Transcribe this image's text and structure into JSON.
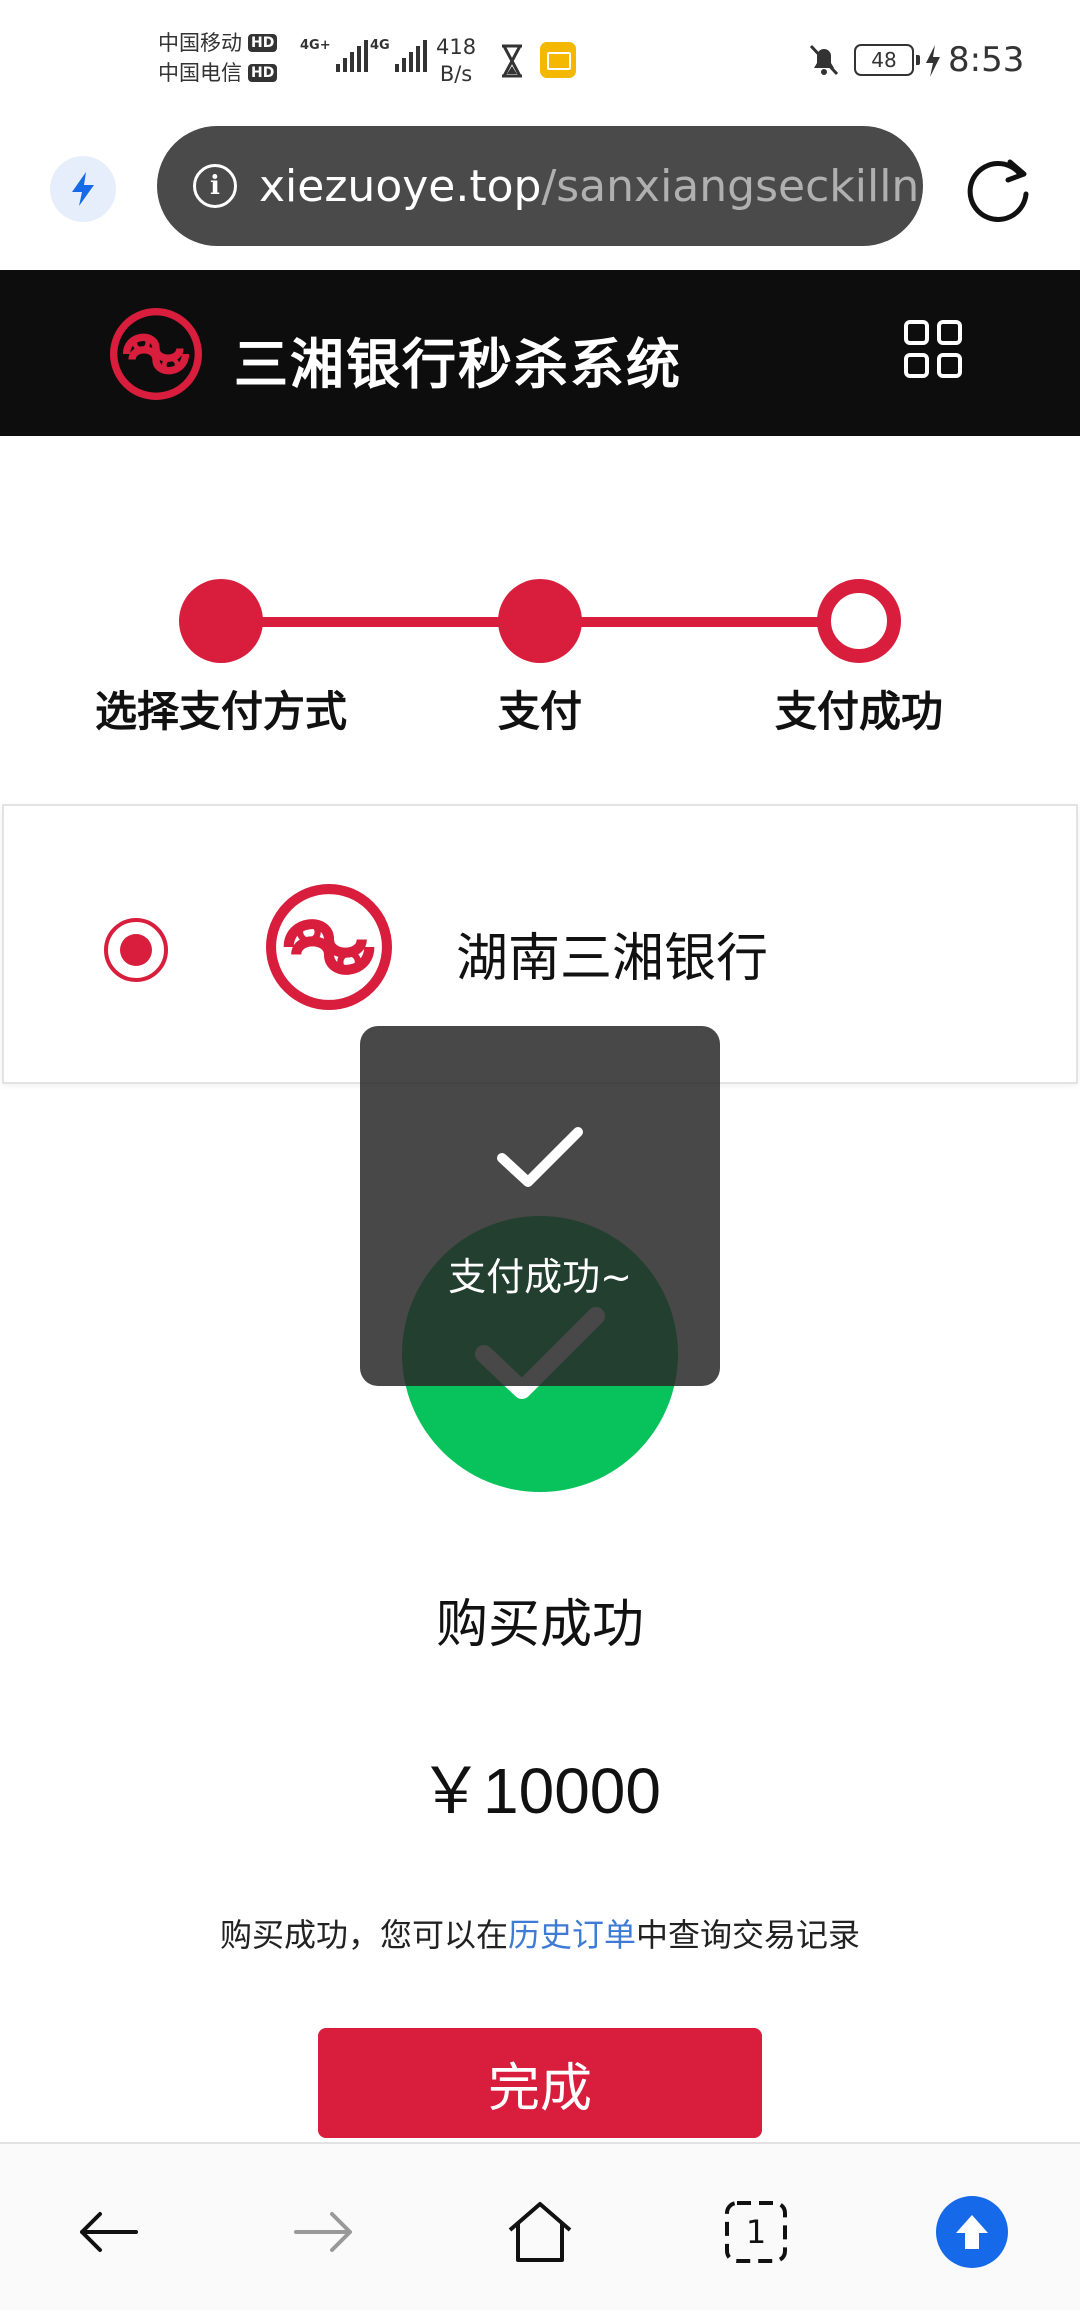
{
  "status_bar": {
    "carrier_1": "中国移动",
    "carrier_2": "中国电信",
    "hd_label": "HD",
    "signal_1_tag": "4G+",
    "signal_2_tag": "4G",
    "net_speed_value": "418",
    "net_speed_unit": "B/s",
    "battery": "48",
    "time": "8:53"
  },
  "browser": {
    "url_host": "xiezuoye.top",
    "url_path": "/sanxiangseckilln"
  },
  "site": {
    "title": "三湘银行秒杀系统",
    "accent_color": "#d81e3c"
  },
  "steps": [
    {
      "label": "选择支付方式",
      "state": "done"
    },
    {
      "label": "支付",
      "state": "done"
    },
    {
      "label": "支付成功",
      "state": "current"
    }
  ],
  "payment_method": {
    "bank_name": "湖南三湘银行",
    "selected": true
  },
  "result": {
    "title": "购买成功",
    "amount": "￥10000",
    "hint_prefix": "购买成功，您可以在",
    "hint_link": "历史订单",
    "hint_suffix": "中查询交易记录",
    "done_label": "完成",
    "success_color": "#08c25c"
  },
  "toast": {
    "text": "支付成功~"
  },
  "bottom_nav": {
    "tab_count": "1",
    "icons": [
      "back-arrow-icon",
      "forward-arrow-icon",
      "home-icon",
      "tabs-icon",
      "upload-icon"
    ]
  }
}
